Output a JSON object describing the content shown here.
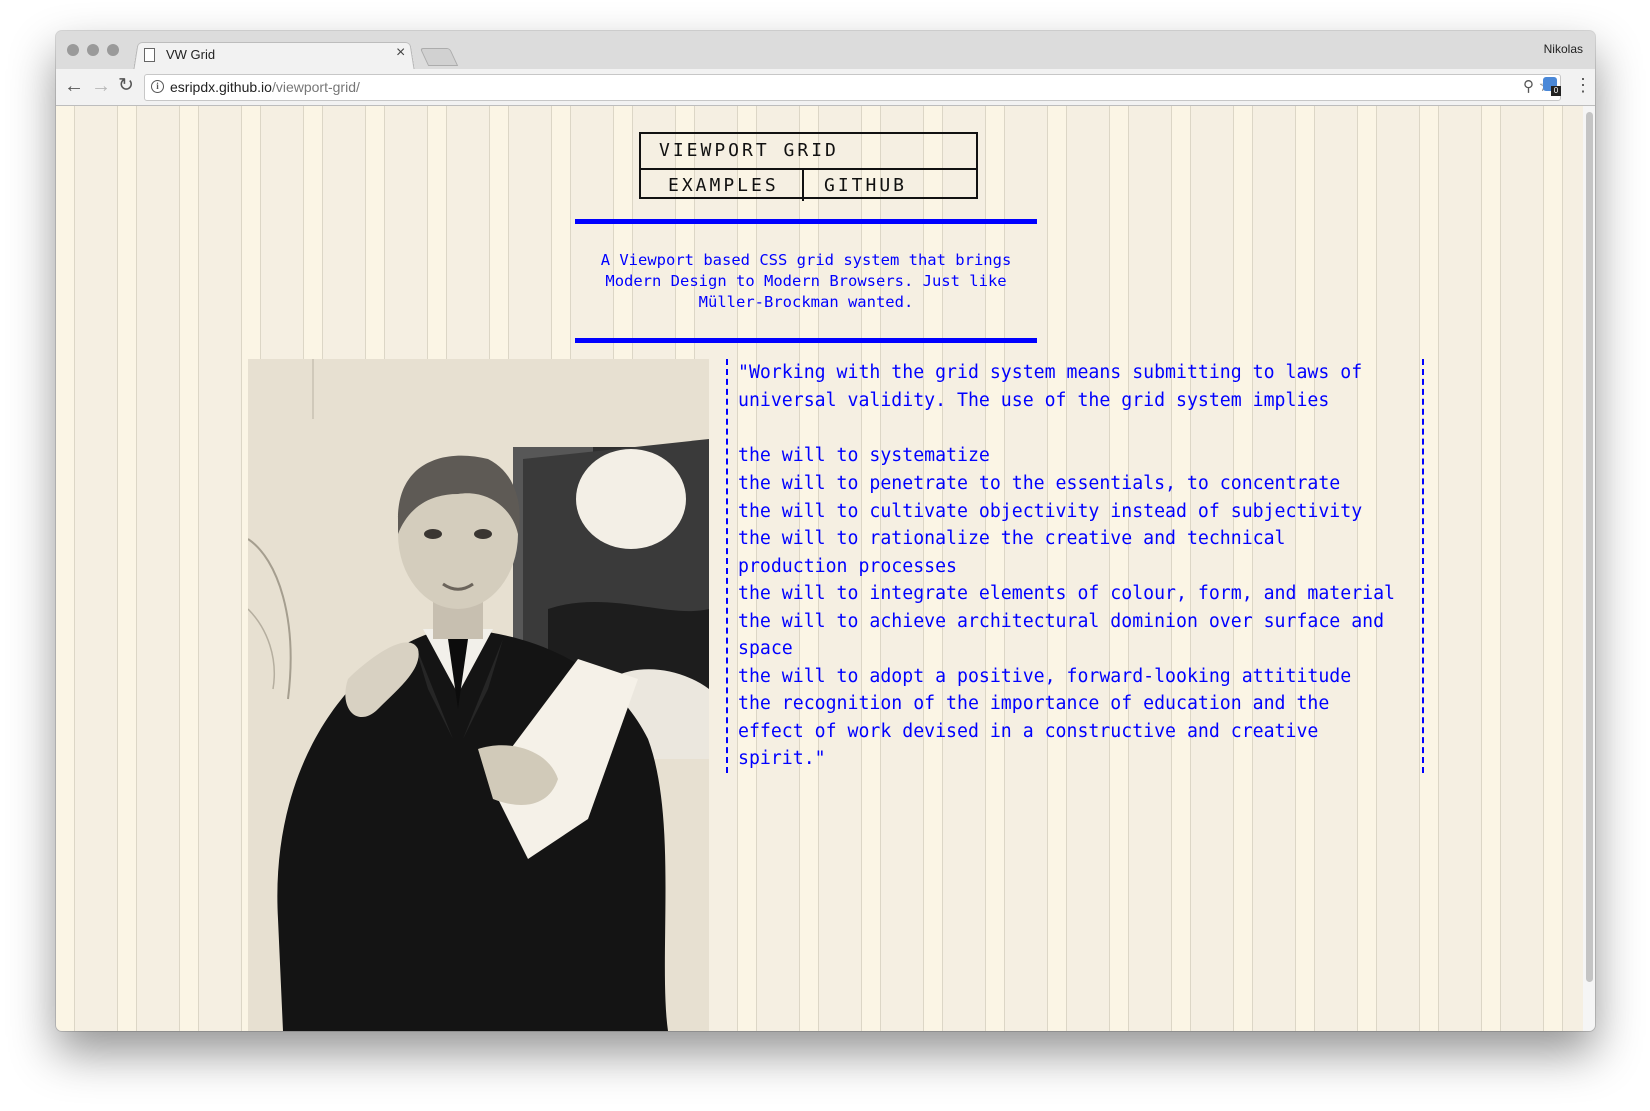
{
  "browser": {
    "tab_title": "VW Grid",
    "profile_name": "Nikolas",
    "url_host": "esripdx.github.io",
    "url_path": "/viewport-grid/",
    "extension_badge": "0",
    "icons": [
      "back-arrow-icon",
      "forward-arrow-icon",
      "reload-icon",
      "info-icon",
      "zoom-icon",
      "star-icon",
      "extension-icon",
      "menu-icon",
      "file-icon",
      "close-icon"
    ]
  },
  "page": {
    "logo_title": "VIEWPORT GRID",
    "nav": {
      "examples": "EXAMPLES",
      "github": "GITHUB"
    },
    "tagline": [
      "A Viewport based CSS grid system that brings",
      "Modern Design to Modern Browsers. Just like",
      "Müller-Brockman wanted."
    ],
    "quote_lines": [
      "\"Working with the grid system means submitting to laws of",
      "universal validity. The use of the grid system implies",
      "",
      "the will to systematize",
      "the will to penetrate to the essentials, to concentrate",
      "the will to cultivate objectivity instead of subjectivity",
      "the will to rationalize the creative and technical",
      "production processes",
      "the will to integrate elements of colour, form, and material",
      "the will to achieve architectural dominion over surface and",
      "space",
      "the will to adopt a positive, forward-looking attititude",
      "the recognition of the importance of education and the",
      "effect of work devised in a constructive and creative",
      "spirit.\""
    ]
  },
  "colors": {
    "accent": "#0000ff",
    "ink": "#111111",
    "paper": "#fbf5e5",
    "column": "#f5efe2"
  }
}
